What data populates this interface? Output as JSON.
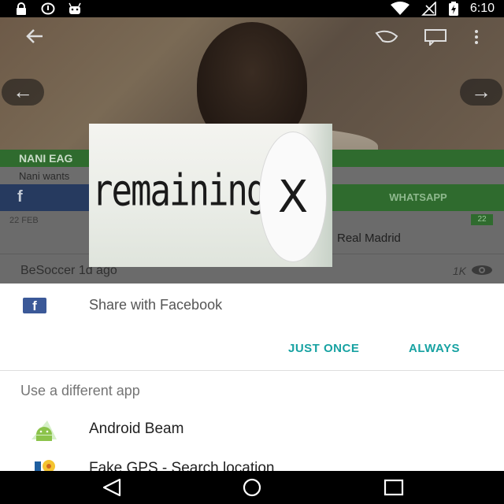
{
  "status_bar": {
    "time": "6:10",
    "left_icons": [
      "lock-icon",
      "data-saver-icon",
      "android-debug-icon"
    ],
    "right_icons": [
      "wifi-icon",
      "no-signal-icon",
      "battery-charging-icon"
    ]
  },
  "background_app": {
    "headline_band": "NANI EAG",
    "subline": "Nani wants",
    "share_facebook": "f",
    "share_whatsapp": "WHATSAPP",
    "card_date": "22 FEB",
    "card_count": "22",
    "card_headline": "Real Madrid",
    "source": "BeSoccer   1d ago",
    "views": "1K"
  },
  "ad": {
    "text": "remaining",
    "close_symbol": "X"
  },
  "share_sheet": {
    "default_app": {
      "icon": "facebook-icon",
      "label": "Share with Facebook"
    },
    "just_once_label": "JUST ONCE",
    "always_label": "ALWAYS",
    "section_title": "Use a different app",
    "apps": [
      {
        "icon": "android-beam-icon",
        "label": "Android Beam"
      },
      {
        "icon": "fake-gps-icon",
        "label": "Fake GPS - Search location"
      }
    ]
  },
  "nav_bar": {
    "buttons": [
      "back-icon",
      "home-icon",
      "recents-icon"
    ]
  },
  "colors": {
    "accent": "#17a2a2",
    "facebook": "#3b5998",
    "besoccer_green": "#2f6b2e"
  }
}
